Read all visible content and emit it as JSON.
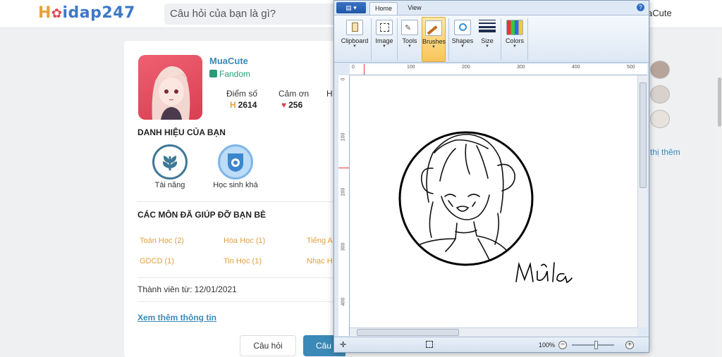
{
  "site": {
    "logo": {
      "first": "H",
      "rest": "idap247"
    },
    "search_placeholder": "Câu hỏi của bạn là gì?",
    "header_user": "aCute",
    "profile": {
      "username": "MuaCute",
      "fandom": "Fandom",
      "stat_labels": [
        "Điểm số",
        "Cảm ơn",
        "H"
      ],
      "points": "2614",
      "thanks": "256"
    },
    "titles_heading": "DANH HIỆU CỦA BẠN",
    "badges": [
      "Tài năng",
      "Học sinh khá"
    ],
    "subjects_heading": "CÁC MÔN ĐÃ GIÚP ĐỠ BẠN BÈ",
    "subjects": [
      "Toán Học (2)",
      "Hóa Học (1)",
      "Tiếng A",
      "GDCD (1)",
      "Tin Học (1)",
      "Nhạc H"
    ],
    "member_since": "Thành viên từ: 12/01/2021",
    "more_link": "Xem thêm thông tin",
    "btn_question": "Câu hỏi",
    "btn_answer": "Câu",
    "side_more": "n thị thêm"
  },
  "paint": {
    "tabs": [
      "Home",
      "View"
    ],
    "groups": [
      "Clipboard",
      "Image",
      "Tools",
      "Brushes",
      "Shapes",
      "Size",
      "Colors"
    ],
    "selected_group": "Brushes",
    "ruler_h": [
      "0",
      "100",
      "200",
      "300",
      "400",
      "500"
    ],
    "ruler_v": [
      "0",
      "100",
      "200",
      "300",
      "400"
    ],
    "zoom": "100%",
    "signature": "Mủa"
  }
}
